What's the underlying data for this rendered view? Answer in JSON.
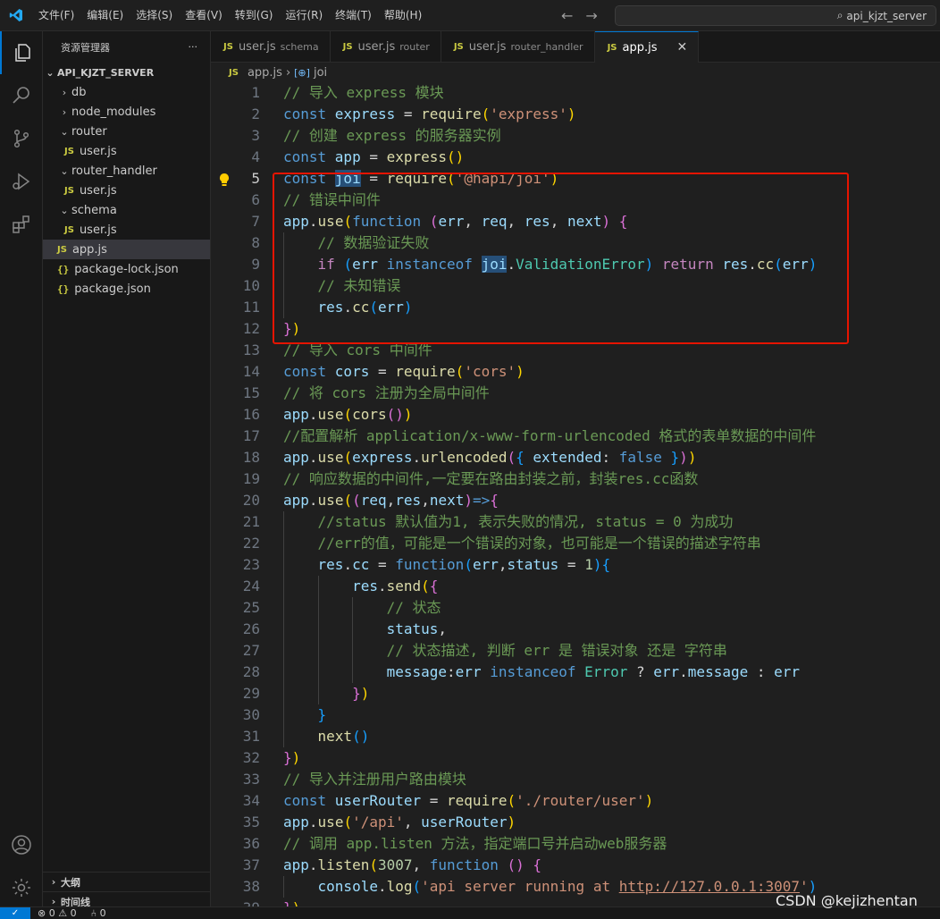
{
  "menu": [
    "文件(F)",
    "编辑(E)",
    "选择(S)",
    "查看(V)",
    "转到(G)",
    "运行(R)",
    "终端(T)",
    "帮助(H)"
  ],
  "search": {
    "text": "api_kjzt_server"
  },
  "sidebar": {
    "title": "资源管理器",
    "more": "···",
    "root": "API_KJZT_SERVER",
    "items": [
      {
        "label": "db",
        "type": "folder",
        "expanded": false,
        "depth": 1
      },
      {
        "label": "node_modules",
        "type": "folder",
        "expanded": false,
        "depth": 1
      },
      {
        "label": "router",
        "type": "folder",
        "expanded": true,
        "depth": 1
      },
      {
        "label": "user.js",
        "type": "js",
        "depth": 2
      },
      {
        "label": "router_handler",
        "type": "folder",
        "expanded": true,
        "depth": 1
      },
      {
        "label": "user.js",
        "type": "js",
        "depth": 2
      },
      {
        "label": "schema",
        "type": "folder",
        "expanded": true,
        "depth": 1
      },
      {
        "label": "user.js",
        "type": "js",
        "depth": 2
      },
      {
        "label": "app.js",
        "type": "js",
        "depth": 1,
        "selected": true
      },
      {
        "label": "package-lock.json",
        "type": "json",
        "depth": 1
      },
      {
        "label": "package.json",
        "type": "json",
        "depth": 1
      }
    ],
    "outline": "大纲",
    "timeline": "时间线"
  },
  "tabs": [
    {
      "name": "user.js",
      "desc": "schema",
      "active": false
    },
    {
      "name": "user.js",
      "desc": "router",
      "active": false
    },
    {
      "name": "user.js",
      "desc": "router_handler",
      "active": false
    },
    {
      "name": "app.js",
      "desc": "",
      "active": true
    }
  ],
  "breadcrumb": {
    "file": "app.js",
    "symbol": "joi"
  },
  "editor": {
    "current_line": 5,
    "lines": [
      [
        [
          "c-com",
          "// 导入 express 模块"
        ]
      ],
      [
        [
          "c-kw",
          "const "
        ],
        [
          "c-var",
          "express"
        ],
        [
          "c-pun",
          " = "
        ],
        [
          "c-fn",
          "require"
        ],
        [
          "c-b1",
          "("
        ],
        [
          "c-str",
          "'express'"
        ],
        [
          "c-b1",
          ")"
        ]
      ],
      [
        [
          "c-com",
          "// 创建 express 的服务器实例"
        ]
      ],
      [
        [
          "c-kw",
          "const "
        ],
        [
          "c-var",
          "app"
        ],
        [
          "c-pun",
          " = "
        ],
        [
          "c-fn",
          "express"
        ],
        [
          "c-b1",
          "()"
        ]
      ],
      [
        [
          "c-kw",
          "const "
        ],
        [
          "c-var hl-word",
          "joi"
        ],
        [
          "c-pun",
          " = "
        ],
        [
          "c-fn",
          "require"
        ],
        [
          "c-b1",
          "("
        ],
        [
          "c-str",
          "'@hapi/joi'"
        ],
        [
          "c-b1",
          ")"
        ]
      ],
      [
        [
          "c-com",
          "// 错误中间件"
        ]
      ],
      [
        [
          "c-var",
          "app"
        ],
        [
          "c-pun",
          "."
        ],
        [
          "c-fn",
          "use"
        ],
        [
          "c-b1",
          "("
        ],
        [
          "c-kw",
          "function "
        ],
        [
          "c-b2",
          "("
        ],
        [
          "c-var",
          "err"
        ],
        [
          "c-pun",
          ", "
        ],
        [
          "c-var",
          "req"
        ],
        [
          "c-pun",
          ", "
        ],
        [
          "c-var",
          "res"
        ],
        [
          "c-pun",
          ", "
        ],
        [
          "c-var",
          "next"
        ],
        [
          "c-b2",
          ")"
        ],
        [
          "c-pun",
          " "
        ],
        [
          "c-b2",
          "{"
        ]
      ],
      [
        [
          "c-pun",
          "    "
        ],
        [
          "c-com",
          "// 数据验证失败"
        ]
      ],
      [
        [
          "c-pun",
          "    "
        ],
        [
          "c-ctl",
          "if "
        ],
        [
          "c-b3",
          "("
        ],
        [
          "c-var",
          "err "
        ],
        [
          "c-kw",
          "instanceof "
        ],
        [
          "c-var hl-word",
          "joi"
        ],
        [
          "c-pun",
          "."
        ],
        [
          "c-cls",
          "ValidationError"
        ],
        [
          "c-b3",
          ")"
        ],
        [
          "c-pun",
          " "
        ],
        [
          "c-ctl",
          "return "
        ],
        [
          "c-var",
          "res"
        ],
        [
          "c-pun",
          "."
        ],
        [
          "c-fn",
          "cc"
        ],
        [
          "c-b3",
          "("
        ],
        [
          "c-var",
          "err"
        ],
        [
          "c-b3",
          ")"
        ]
      ],
      [
        [
          "c-pun",
          "    "
        ],
        [
          "c-com",
          "// 未知错误"
        ]
      ],
      [
        [
          "c-pun",
          "    "
        ],
        [
          "c-var",
          "res"
        ],
        [
          "c-pun",
          "."
        ],
        [
          "c-fn",
          "cc"
        ],
        [
          "c-b3",
          "("
        ],
        [
          "c-var",
          "err"
        ],
        [
          "c-b3",
          ")"
        ]
      ],
      [
        [
          "c-b2",
          "}"
        ],
        [
          "c-b1",
          ")"
        ]
      ],
      [
        [
          "c-com",
          "// 导入 cors 中间件"
        ]
      ],
      [
        [
          "c-kw",
          "const "
        ],
        [
          "c-var",
          "cors"
        ],
        [
          "c-pun",
          " = "
        ],
        [
          "c-fn",
          "require"
        ],
        [
          "c-b1",
          "("
        ],
        [
          "c-str",
          "'cors'"
        ],
        [
          "c-b1",
          ")"
        ]
      ],
      [
        [
          "c-com",
          "// 将 cors 注册为全局中间件"
        ]
      ],
      [
        [
          "c-var",
          "app"
        ],
        [
          "c-pun",
          "."
        ],
        [
          "c-fn",
          "use"
        ],
        [
          "c-b1",
          "("
        ],
        [
          "c-fn",
          "cors"
        ],
        [
          "c-b2",
          "()"
        ],
        [
          "c-b1",
          ")"
        ]
      ],
      [
        [
          "c-com",
          "//配置解析 application/x-www-form-urlencoded 格式的表单数据的中间件"
        ]
      ],
      [
        [
          "c-var",
          "app"
        ],
        [
          "c-pun",
          "."
        ],
        [
          "c-fn",
          "use"
        ],
        [
          "c-b1",
          "("
        ],
        [
          "c-var",
          "express"
        ],
        [
          "c-pun",
          "."
        ],
        [
          "c-fn",
          "urlencoded"
        ],
        [
          "c-b2",
          "("
        ],
        [
          "c-b3",
          "{ "
        ],
        [
          "c-var",
          "extended"
        ],
        [
          "c-pun",
          ": "
        ],
        [
          "c-kw",
          "false"
        ],
        [
          "c-b3",
          " }"
        ],
        [
          "c-b2",
          ")"
        ],
        [
          "c-b1",
          ")"
        ]
      ],
      [
        [
          "c-com",
          "// 响应数据的中间件,一定要在路由封装之前，封装res.cc函数"
        ]
      ],
      [
        [
          "c-var",
          "app"
        ],
        [
          "c-pun",
          "."
        ],
        [
          "c-fn",
          "use"
        ],
        [
          "c-b1",
          "("
        ],
        [
          "c-b2",
          "("
        ],
        [
          "c-var",
          "req"
        ],
        [
          "c-pun",
          ","
        ],
        [
          "c-var",
          "res"
        ],
        [
          "c-pun",
          ","
        ],
        [
          "c-var",
          "next"
        ],
        [
          "c-b2",
          ")"
        ],
        [
          "c-kw",
          "=>"
        ],
        [
          "c-b2",
          "{"
        ]
      ],
      [
        [
          "c-pun",
          "    "
        ],
        [
          "c-com",
          "//status 默认值为1, 表示失败的情况, status = 0 为成功"
        ]
      ],
      [
        [
          "c-pun",
          "    "
        ],
        [
          "c-com",
          "//err的值，可能是一个错误的对象，也可能是一个错误的描述字符串"
        ]
      ],
      [
        [
          "c-pun",
          "    "
        ],
        [
          "c-var",
          "res"
        ],
        [
          "c-pun",
          "."
        ],
        [
          "c-var",
          "cc"
        ],
        [
          "c-pun",
          " = "
        ],
        [
          "c-kw",
          "function"
        ],
        [
          "c-b3",
          "("
        ],
        [
          "c-var",
          "err"
        ],
        [
          "c-pun",
          ","
        ],
        [
          "c-var",
          "status"
        ],
        [
          "c-pun",
          " = "
        ],
        [
          "c-num",
          "1"
        ],
        [
          "c-b3",
          ")"
        ],
        [
          "c-b3",
          "{"
        ]
      ],
      [
        [
          "c-pun",
          "        "
        ],
        [
          "c-var",
          "res"
        ],
        [
          "c-pun",
          "."
        ],
        [
          "c-fn",
          "send"
        ],
        [
          "c-b1",
          "("
        ],
        [
          "c-b2",
          "{"
        ]
      ],
      [
        [
          "c-pun",
          "            "
        ],
        [
          "c-com",
          "// 状态"
        ]
      ],
      [
        [
          "c-pun",
          "            "
        ],
        [
          "c-var",
          "status"
        ],
        [
          "c-pun",
          ","
        ]
      ],
      [
        [
          "c-pun",
          "            "
        ],
        [
          "c-com",
          "// 状态描述, 判断 err 是 错误对象 还是 字符串"
        ]
      ],
      [
        [
          "c-pun",
          "            "
        ],
        [
          "c-var",
          "message"
        ],
        [
          "c-pun",
          ":"
        ],
        [
          "c-var",
          "err "
        ],
        [
          "c-kw",
          "instanceof "
        ],
        [
          "c-cls",
          "Error"
        ],
        [
          "c-pun",
          " ? "
        ],
        [
          "c-var",
          "err"
        ],
        [
          "c-pun",
          "."
        ],
        [
          "c-var",
          "message"
        ],
        [
          "c-pun",
          " : "
        ],
        [
          "c-var",
          "err"
        ]
      ],
      [
        [
          "c-pun",
          "        "
        ],
        [
          "c-b2",
          "}"
        ],
        [
          "c-b1",
          ")"
        ]
      ],
      [
        [
          "c-pun",
          "    "
        ],
        [
          "c-b3",
          "}"
        ]
      ],
      [
        [
          "c-pun",
          "    "
        ],
        [
          "c-fn",
          "next"
        ],
        [
          "c-b3",
          "()"
        ]
      ],
      [
        [
          "c-b2",
          "}"
        ],
        [
          "c-b1",
          ")"
        ]
      ],
      [
        [
          "c-com",
          "// 导入并注册用户路由模块"
        ]
      ],
      [
        [
          "c-kw",
          "const "
        ],
        [
          "c-var",
          "userRouter"
        ],
        [
          "c-pun",
          " = "
        ],
        [
          "c-fn",
          "require"
        ],
        [
          "c-b1",
          "("
        ],
        [
          "c-str",
          "'./router/user'"
        ],
        [
          "c-b1",
          ")"
        ]
      ],
      [
        [
          "c-var",
          "app"
        ],
        [
          "c-pun",
          "."
        ],
        [
          "c-fn",
          "use"
        ],
        [
          "c-b1",
          "("
        ],
        [
          "c-str",
          "'/api'"
        ],
        [
          "c-pun",
          ", "
        ],
        [
          "c-var",
          "userRouter"
        ],
        [
          "c-b1",
          ")"
        ]
      ],
      [
        [
          "c-com",
          "// 调用 app.listen 方法，指定端口号并启动web服务器"
        ]
      ],
      [
        [
          "c-var",
          "app"
        ],
        [
          "c-pun",
          "."
        ],
        [
          "c-fn",
          "listen"
        ],
        [
          "c-b1",
          "("
        ],
        [
          "c-num",
          "3007"
        ],
        [
          "c-pun",
          ", "
        ],
        [
          "c-kw",
          "function "
        ],
        [
          "c-b2",
          "()"
        ],
        [
          "c-pun",
          " "
        ],
        [
          "c-b2",
          "{"
        ]
      ],
      [
        [
          "c-pun",
          "    "
        ],
        [
          "c-var",
          "console"
        ],
        [
          "c-pun",
          "."
        ],
        [
          "c-fn",
          "log"
        ],
        [
          "c-b3",
          "("
        ],
        [
          "c-str",
          "'api server running at "
        ],
        [
          "c-str link",
          "http://127.0.0.1:3007"
        ],
        [
          "c-str",
          "'"
        ],
        [
          "c-b3",
          ")"
        ]
      ],
      [
        [
          "c-b2",
          "}"
        ],
        [
          "c-b1",
          ")"
        ]
      ]
    ],
    "indent_guides": {
      "8": [
        1
      ],
      "9": [
        1
      ],
      "10": [
        1
      ],
      "11": [
        1
      ],
      "21": [
        1
      ],
      "22": [
        1
      ],
      "23": [
        1
      ],
      "24": [
        1,
        2
      ],
      "25": [
        1,
        2,
        3
      ],
      "26": [
        1,
        2,
        3
      ],
      "27": [
        1,
        2,
        3
      ],
      "28": [
        1,
        2,
        3
      ],
      "29": [
        1,
        2
      ],
      "30": [
        1
      ],
      "31": [
        1
      ],
      "38": [
        1
      ]
    }
  },
  "statusbar": {
    "problems": "⊗ 0 ⚠ 0",
    "ports": "⑃ 0"
  },
  "watermark": "CSDN @kejizhentan"
}
